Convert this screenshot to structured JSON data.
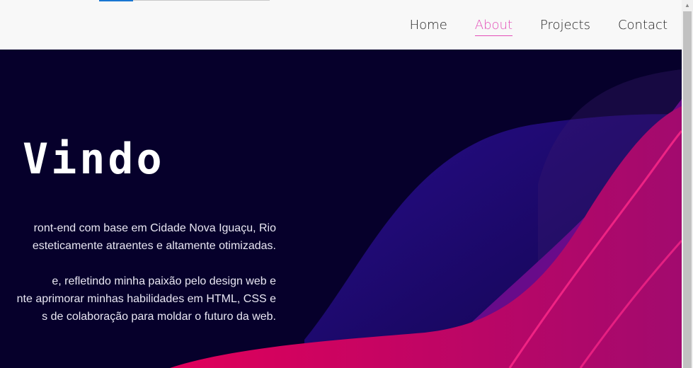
{
  "nav": {
    "items": [
      {
        "label": "Home",
        "active": false
      },
      {
        "label": "About",
        "active": true
      },
      {
        "label": "Projects",
        "active": false
      },
      {
        "label": "Contact",
        "active": false
      }
    ],
    "active_color": "#e34db8",
    "accent_color": "#1976d2"
  },
  "hero": {
    "title": "Vindo",
    "paragraph1": [
      "ront-end com base em Cidade Nova Iguaçu, Rio",
      "esteticamente atraentes e altamente otimizadas."
    ],
    "paragraph2": [
      "e, refletindo minha paixão pelo design web e",
      "nte aprimorar minhas habilidades em HTML, CSS e",
      "s de colaboração para moldar o futuro da web."
    ],
    "background_color": "#06002b",
    "wave_colors": [
      "#2a0e8f",
      "#6a0a8e",
      "#c4004f",
      "#8a1290"
    ]
  },
  "scrollbar": {
    "up_icon": "chevron-up-icon"
  }
}
